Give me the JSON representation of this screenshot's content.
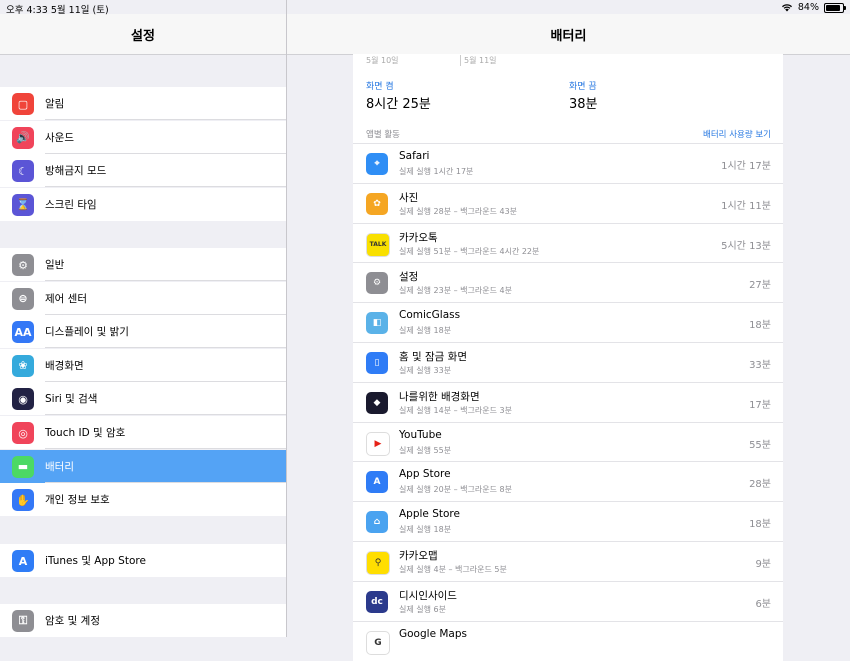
{
  "status_bar": {
    "time_date": "오후 4:33   5월 11일 (토)",
    "battery": "84%"
  },
  "sidebar": {
    "title": "설정",
    "groups": [
      [
        {
          "label": "알림",
          "icon": "notifications-icon",
          "color": "#f0443a"
        },
        {
          "label": "사운드",
          "icon": "sound-icon",
          "color": "#f0445a"
        },
        {
          "label": "방해금지 모드",
          "icon": "moon-icon",
          "color": "#5b55d6"
        },
        {
          "label": "스크린 타임",
          "icon": "hourglass-icon",
          "color": "#5b55d6"
        }
      ],
      [
        {
          "label": "일반",
          "icon": "gear-icon",
          "color": "#8e8e93"
        },
        {
          "label": "제어 센터",
          "icon": "control-center-icon",
          "color": "#8e8e93"
        },
        {
          "label": "디스플레이 및 밝기",
          "icon": "display-icon",
          "color": "#3478f6"
        },
        {
          "label": "배경화면",
          "icon": "wallpaper-icon",
          "color": "#35aadc"
        },
        {
          "label": "Siri 및 검색",
          "icon": "siri-icon",
          "color": "#222244"
        },
        {
          "label": "Touch ID 및 암호",
          "icon": "fingerprint-icon",
          "color": "#f0445a"
        },
        {
          "label": "배터리",
          "icon": "battery-icon",
          "color": "#4cd964"
        },
        {
          "label": "개인 정보 보호",
          "icon": "hand-icon",
          "color": "#3478f6"
        }
      ],
      [
        {
          "label": "iTunes 및 App Store",
          "icon": "app-store-icon",
          "color": "#2f7cf6"
        }
      ],
      [
        {
          "label": "암호 및 계정",
          "icon": "key-icon",
          "color": "#8e8e93"
        }
      ]
    ],
    "selected": "배터리"
  },
  "main": {
    "title": "배터리",
    "chart_dates": [
      "5월 10일",
      "5월 11일"
    ],
    "screen_on_label": "화면 켬",
    "screen_on_value": "8시간 25분",
    "screen_off_label": "화면 끔",
    "screen_off_value": "38분",
    "section_title": "앱별 활동",
    "section_link": "배터리 사용량 보기",
    "apps": [
      {
        "name": "Safari",
        "detail": "실제 실행 1시간 17분",
        "time": "1시간 17분",
        "icon": "safari-icon",
        "color": "#2f8ef5"
      },
      {
        "name": "사진",
        "detail": "실제 실행 28분 – 백그라운드 43분",
        "time": "1시간 11분",
        "icon": "photos-icon",
        "color": "#f5a623"
      },
      {
        "name": "카카오톡",
        "detail": "실제 실행 51분 – 백그라운드 4시간 22분",
        "time": "5시간 13분",
        "icon": "kakaotalk-icon",
        "color": "#f9e000"
      },
      {
        "name": "설정",
        "detail": "실제 실행 23분 – 백그라운드 4분",
        "time": "27분",
        "icon": "settings-gear-icon",
        "color": "#8e8e93"
      },
      {
        "name": "ComicGlass",
        "detail": "실제 실행 18분",
        "time": "18분",
        "icon": "comicglass-icon",
        "color": "#5ab2e8"
      },
      {
        "name": "홈 및 잠금 화면",
        "detail": "실제 실행 33분",
        "time": "33분",
        "icon": "home-lock-icon",
        "color": "#2f7cf6"
      },
      {
        "name": "나를위한 배경화면",
        "detail": "실제 실행 14분 – 백그라운드 3분",
        "time": "17분",
        "icon": "wallpaper-app-icon",
        "color": "#1a1a2e"
      },
      {
        "name": "YouTube",
        "detail": "실제 실행 55분",
        "time": "55분",
        "icon": "youtube-icon",
        "color": "#ffffff"
      },
      {
        "name": "App Store",
        "detail": "실제 실행 20분 – 백그라운드 8분",
        "time": "28분",
        "icon": "app-store-icon",
        "color": "#2f7cf6"
      },
      {
        "name": "Apple Store",
        "detail": "실제 실행 18분",
        "time": "18분",
        "icon": "apple-store-icon",
        "color": "#4aa3f0"
      },
      {
        "name": "카카오맵",
        "detail": "실제 실행 4분 – 백그라운드 5분",
        "time": "9분",
        "icon": "kakaomap-icon",
        "color": "#ffde00"
      },
      {
        "name": "디시인사이드",
        "detail": "실제 실행 6분",
        "time": "6분",
        "icon": "dcinside-icon",
        "color": "#2b3a8c"
      },
      {
        "name": "Google Maps",
        "detail": "",
        "time": "",
        "icon": "google-maps-icon",
        "color": "#ffffff"
      }
    ]
  }
}
